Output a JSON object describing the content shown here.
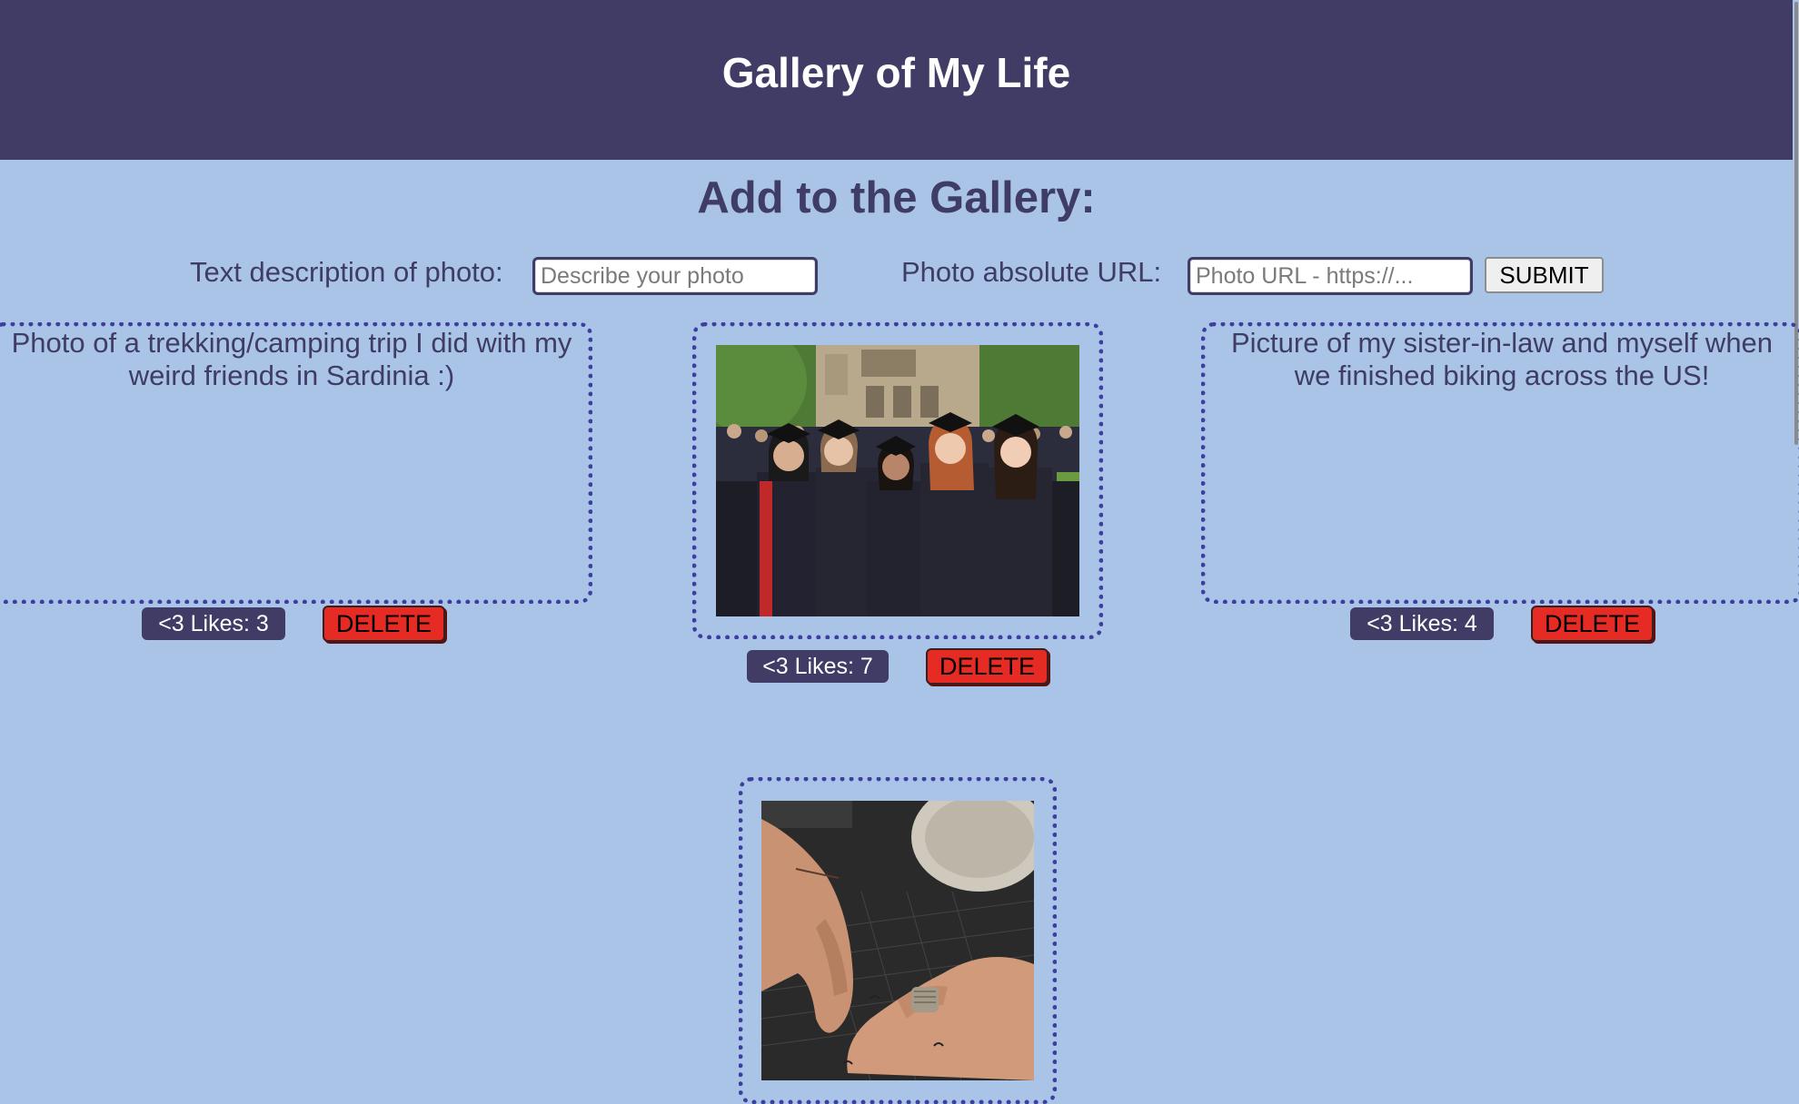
{
  "header": {
    "title": "Gallery of My Life"
  },
  "form": {
    "title": "Add to the Gallery:",
    "description_label": "Text description of photo:",
    "description_placeholder": "Describe your photo",
    "description_value": "",
    "url_label": "Photo absolute URL:",
    "url_placeholder": "Photo URL - https://...",
    "url_value": "",
    "submit_label": "SUBMIT"
  },
  "gallery": [
    {
      "type": "text",
      "description": "Photo of a trekking/camping trip I did with my weird friends in Sardinia :)",
      "likes_label": "<3 Likes: 3",
      "delete_label": "DELETE"
    },
    {
      "type": "image",
      "alt": "Graduation photo of five women in caps and gowns",
      "likes_label": "<3 Likes: 7",
      "delete_label": "DELETE"
    },
    {
      "type": "text",
      "description": "Picture of my sister-in-law and myself when we finished biking across the US!",
      "likes_label": "<3 Likes: 4",
      "delete_label": "DELETE"
    },
    {
      "type": "image",
      "alt": "Hands with small finger tattoos and a ring",
      "likes_label": "",
      "delete_label": ""
    }
  ],
  "colors": {
    "header_bg": "#403c66",
    "page_bg": "#aac4e8",
    "text": "#3f3c67",
    "card_border": "#3d3ea0",
    "likes_bg": "#403c66",
    "delete_bg": "#e52b24"
  }
}
